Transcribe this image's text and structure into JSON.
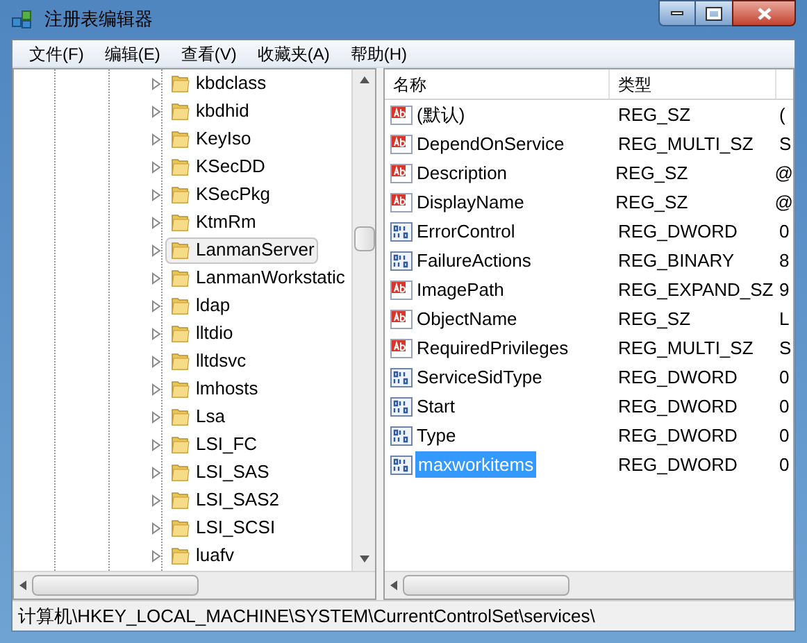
{
  "window": {
    "title": "注册表编辑器"
  },
  "menu": [
    {
      "label": "文件(F)"
    },
    {
      "label": "编辑(E)"
    },
    {
      "label": "查看(V)"
    },
    {
      "label": "收藏夹(A)"
    },
    {
      "label": "帮助(H)"
    }
  ],
  "tree": {
    "items": [
      {
        "label": "kbdclass",
        "selected": false
      },
      {
        "label": "kbdhid",
        "selected": false
      },
      {
        "label": "KeyIso",
        "selected": false
      },
      {
        "label": "KSecDD",
        "selected": false
      },
      {
        "label": "KSecPkg",
        "selected": false
      },
      {
        "label": "KtmRm",
        "selected": false
      },
      {
        "label": "LanmanServer",
        "selected": true
      },
      {
        "label": "LanmanWorkstatic",
        "selected": false
      },
      {
        "label": "ldap",
        "selected": false
      },
      {
        "label": "lltdio",
        "selected": false
      },
      {
        "label": "lltdsvc",
        "selected": false
      },
      {
        "label": "lmhosts",
        "selected": false
      },
      {
        "label": "Lsa",
        "selected": false
      },
      {
        "label": "LSI_FC",
        "selected": false
      },
      {
        "label": "LSI_SAS",
        "selected": false
      },
      {
        "label": "LSI_SAS2",
        "selected": false
      },
      {
        "label": "LSI_SCSI",
        "selected": false
      },
      {
        "label": "luafv",
        "selected": false
      }
    ]
  },
  "table": {
    "columns": [
      "名称",
      "类型"
    ],
    "rows": [
      {
        "kind": "string",
        "name": "(默认)",
        "type": "REG_SZ",
        "column_3": "(",
        "selected": false
      },
      {
        "kind": "string",
        "name": "DependOnService",
        "type": "REG_MULTI_SZ",
        "column_3": "S",
        "selected": false
      },
      {
        "kind": "string",
        "name": "Description",
        "type": "REG_SZ",
        "column_3": "@",
        "selected": false
      },
      {
        "kind": "string",
        "name": "DisplayName",
        "type": "REG_SZ",
        "column_3": "@",
        "selected": false
      },
      {
        "kind": "binary",
        "name": "ErrorControl",
        "type": "REG_DWORD",
        "column_3": "0",
        "selected": false
      },
      {
        "kind": "binary",
        "name": "FailureActions",
        "type": "REG_BINARY",
        "column_3": "8",
        "selected": false
      },
      {
        "kind": "string",
        "name": "ImagePath",
        "type": "REG_EXPAND_SZ",
        "column_3": "9",
        "selected": false
      },
      {
        "kind": "string",
        "name": "ObjectName",
        "type": "REG_SZ",
        "column_3": "L",
        "selected": false
      },
      {
        "kind": "string",
        "name": "RequiredPrivileges",
        "type": "REG_MULTI_SZ",
        "column_3": "S",
        "selected": false
      },
      {
        "kind": "binary",
        "name": "ServiceSidType",
        "type": "REG_DWORD",
        "column_3": "0",
        "selected": false
      },
      {
        "kind": "binary",
        "name": "Start",
        "type": "REG_DWORD",
        "column_3": "0",
        "selected": false
      },
      {
        "kind": "binary",
        "name": "Type",
        "type": "REG_DWORD",
        "column_3": "0",
        "selected": false
      },
      {
        "kind": "binary",
        "name": "maxworkitems",
        "type": "REG_DWORD",
        "column_3": "0",
        "selected": true
      }
    ]
  },
  "status_bar": "计算机\\HKEY_LOCAL_MACHINE\\SYSTEM\\CurrentControlSet\\services\\"
}
